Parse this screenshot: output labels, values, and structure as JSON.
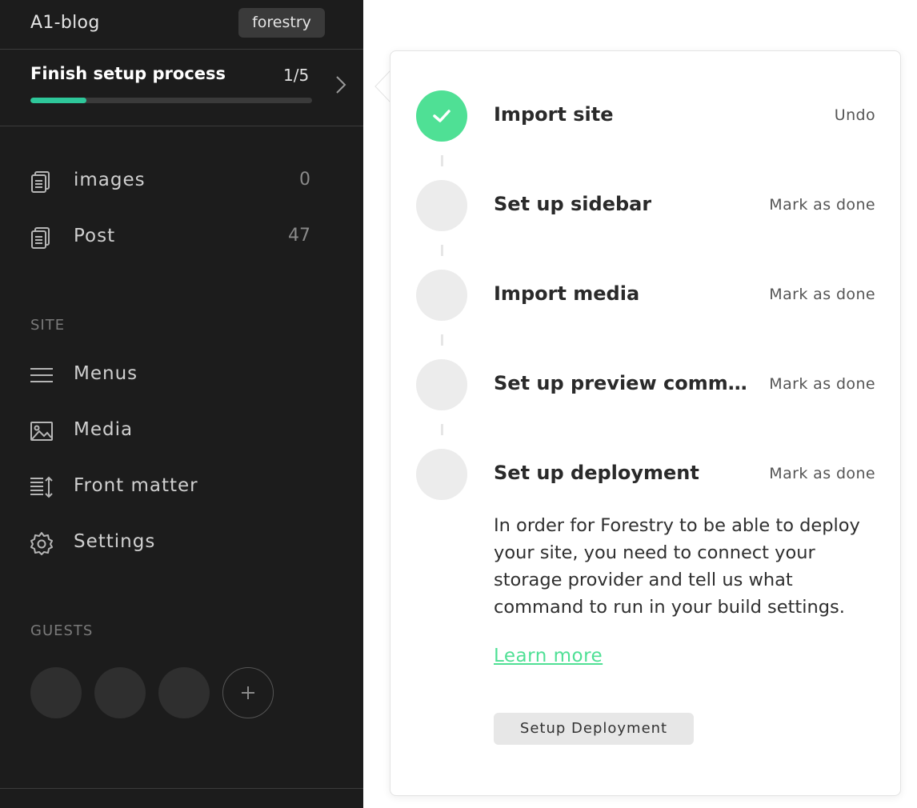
{
  "sidebar": {
    "site_name": "A1-blog",
    "badge": "forestry",
    "setup": {
      "title": "Finish setup process",
      "count": "1/5",
      "progress": 0.2
    },
    "collections": [
      {
        "label": "images",
        "count": "0",
        "icon": "collection-icon"
      },
      {
        "label": "Post",
        "count": "47",
        "icon": "collection-icon"
      }
    ],
    "site_section": {
      "heading": "SITE",
      "items": [
        {
          "label": "Menus",
          "icon": "menu-icon"
        },
        {
          "label": "Media",
          "icon": "image-icon"
        },
        {
          "label": "Front matter",
          "icon": "front-matter-icon"
        },
        {
          "label": "Settings",
          "icon": "gear-icon"
        }
      ]
    },
    "guests_section": {
      "heading": "GUESTS",
      "add_icon": "plus-icon"
    }
  },
  "setup_popover": {
    "steps": [
      {
        "title": "Import site",
        "action": "Undo",
        "done": true
      },
      {
        "title": "Set up sidebar",
        "action": "Mark as done",
        "done": false
      },
      {
        "title": "Import media",
        "action": "Mark as done",
        "done": false
      },
      {
        "title": "Set up preview comma…",
        "action": "Mark as done",
        "done": false
      },
      {
        "title": "Set up deployment",
        "action": "Mark as done",
        "done": false
      }
    ],
    "description": "In order for Forestry to be able to deploy your site, you need to connect your storage provider and tell us what command to run in your build settings.",
    "learn_more": "Learn more",
    "button": "Setup Deployment"
  },
  "colors": {
    "sidebar_bg": "#1c1c1c",
    "accent": "#4fe095",
    "progress": "#2ec79a"
  }
}
